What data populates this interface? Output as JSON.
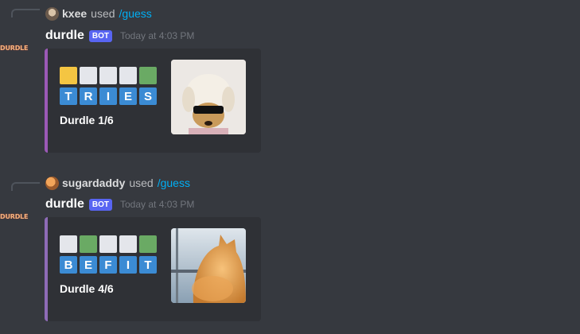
{
  "colors": {
    "background": "#36393f",
    "embed_bg": "#2f3136",
    "embed_border_1": "#9b59b6",
    "embed_border_2": "#8e6bb7",
    "tile_yellow": "#f4c542",
    "tile_green": "#6aaa64",
    "tile_white": "#e4e6eb",
    "letter_tile": "#3b8bd4",
    "bot_tag": "#5865f2",
    "link": "#00aff4"
  },
  "messages": [
    {
      "reply": {
        "user": "kxee",
        "used": "used",
        "command": "/guess"
      },
      "bot_avatar_text": "DURDLE",
      "bot_name": "durdle",
      "bot_tag": "BOT",
      "timestamp": "Today at 4:03 PM",
      "tiles": [
        "yellow",
        "white",
        "white",
        "white",
        "green"
      ],
      "letters": [
        "T",
        "R",
        "I",
        "E",
        "S"
      ],
      "score": "Durdle 1/6",
      "thumbnail_icon": "dog-sunglasses-image"
    },
    {
      "reply": {
        "user": "sugardaddy",
        "used": "used",
        "command": "/guess"
      },
      "bot_avatar_text": "DURDLE",
      "bot_name": "durdle",
      "bot_tag": "BOT",
      "timestamp": "Today at 4:03 PM",
      "tiles": [
        "white",
        "green",
        "white",
        "white",
        "green"
      ],
      "letters": [
        "B",
        "E",
        "F",
        "I",
        "T"
      ],
      "score": "Durdle 4/6",
      "thumbnail_icon": "orange-cat-image"
    }
  ]
}
